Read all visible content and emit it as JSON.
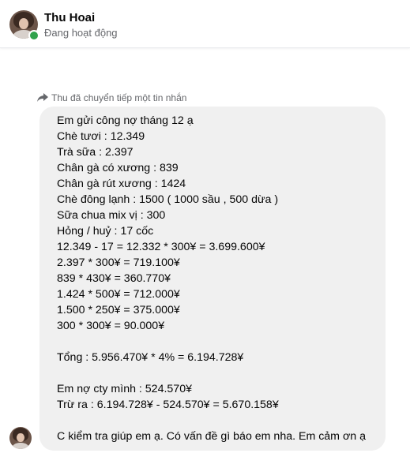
{
  "header": {
    "name": "Thu Hoai",
    "status": "Đang hoạt động",
    "colors": {
      "online": "#31a24c"
    }
  },
  "conversation": {
    "forward_note": "Thu đã chuyển tiếp một tin nhắn",
    "message_lines": [
      "Em gửi công nợ tháng 12 ạ",
      "Chè tươi : 12.349",
      "Trà sữa : 2.397",
      "Chân gà có xương : 839",
      "Chân gà rút xương : 1424",
      "Chè đông lạnh : 1500 ( 1000 sầu , 500 dừa )",
      "Sữa chua mix vị : 300",
      "Hỏng / huỷ : 17 cốc",
      "12.349 - 17 = 12.332 * 300¥ = 3.699.600¥",
      "2.397 * 300¥ = 719.100¥",
      "839 * 430¥ = 360.770¥",
      "1.424 * 500¥ = 712.000¥",
      "1.500 * 250¥ = 375.000¥",
      "300 * 300¥ = 90.000¥",
      "",
      "Tổng : 5.956.470¥ * 4% = 6.194.728¥",
      "",
      "Em nợ cty mình : 524.570¥",
      "Trừ ra : 6.194.728¥ - 524.570¥ = 5.670.158¥",
      "",
      "C kiểm tra giúp em ạ. Có vấn đề gì báo em nha. Em cảm ơn ạ"
    ]
  }
}
